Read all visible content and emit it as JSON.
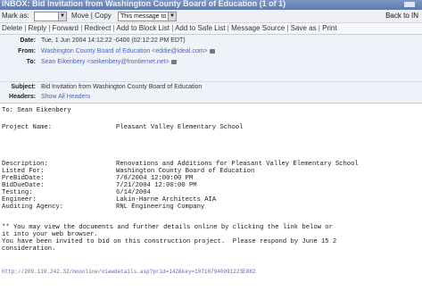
{
  "window": {
    "title": "INBOX: Bid Invitation from Washington County Board of Education (1 of 1)"
  },
  "toolbar": {
    "mark_as_label": "Mark as:",
    "move_copy_label": "Move | Copy",
    "folder_select": "This message to",
    "back_link": "Back to IN"
  },
  "actions": [
    "Delete",
    "Reply",
    "Forward",
    "Redirect",
    "Add to Block List",
    "Add to Safe List",
    "Message Source",
    "Save as",
    "Print"
  ],
  "headers": {
    "date_label": "Date:",
    "date_value": "Tue, 1 Jun 2004 14:12:22 -0400 (02:12:22 PM EDT)",
    "from_label": "From:",
    "from_value": "Washington County Board of Education <eddie@ideal.com>",
    "to_label": "To:",
    "to_value": "Sean Eikenbery <seikenbery@frontiernet.net>",
    "subject_label": "Subject:",
    "subject_value": "Bid Invitation from Washington County Board of Education",
    "headers_label": "Headers:",
    "headers_value": "Show All Headers"
  },
  "message": {
    "to_line": "To: Sean Eikenbery",
    "project_label": "Project Name:",
    "project_value": "Pleasant Valley Elementary School",
    "details": [
      {
        "label": "Description:",
        "value": "Renovations and Additions for Pleasant Valley Elementary School"
      },
      {
        "label": "Listed For:",
        "value": "Washington County Board of Education"
      },
      {
        "label": "PreBidDate:",
        "value": "7/8/2004 12:00:00 PM"
      },
      {
        "label": "BidDueDate:",
        "value": "7/21/2004 12:00:00 PM"
      },
      {
        "label": "Testing:",
        "value": "6/14/2004"
      },
      {
        "label": "Engineer:",
        "value": "Lakin-Harne Architects AIA"
      },
      {
        "label": "Auditing Agency:",
        "value": "RNL Engineering Company"
      }
    ],
    "paragraph": [
      "** You may view the documents and further details online by clicking the link below or",
      "it into your web browser.",
      "You have been invited to bid on this construction project.  Please respond by June 15 2",
      "consideration."
    ],
    "url": "http://209.119.242.32/moonline/viewdetails.asp?prid=142&key=107107940091223E882"
  }
}
